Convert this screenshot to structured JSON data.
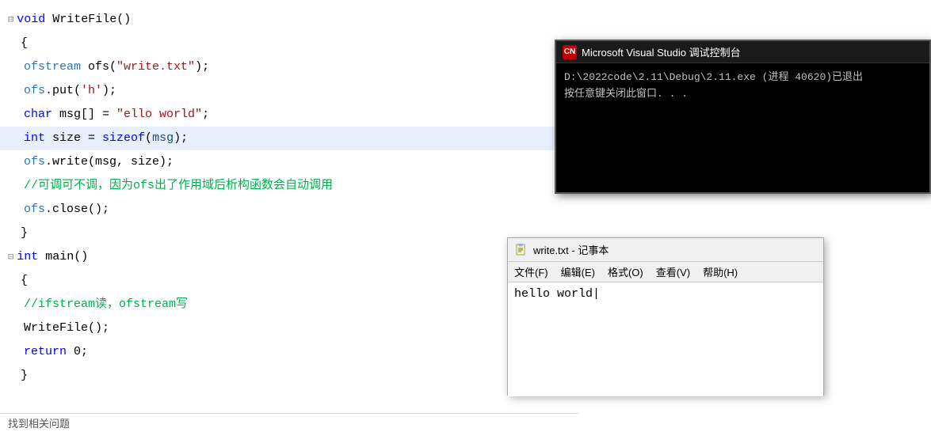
{
  "editor": {
    "lines": [
      {
        "id": "l1",
        "type": "fn-header",
        "collapse": "⊟",
        "indent": 0,
        "tokens": [
          {
            "cls": "kw-void",
            "t": "void"
          },
          {
            "cls": "normal",
            "t": " WriteFile()"
          }
        ]
      },
      {
        "id": "l2",
        "type": "brace",
        "indent": 0,
        "tokens": [
          {
            "cls": "normal",
            "t": "{"
          }
        ]
      },
      {
        "id": "l3",
        "indent": 1,
        "tokens": [
          {
            "cls": "obj-name",
            "t": "ofstream"
          },
          {
            "cls": "normal",
            "t": " ofs("
          },
          {
            "cls": "str-val",
            "t": "\"write.txt\""
          },
          {
            "cls": "normal",
            "t": ");"
          }
        ]
      },
      {
        "id": "l4",
        "indent": 1,
        "tokens": [
          {
            "cls": "obj-name",
            "t": "ofs"
          },
          {
            "cls": "normal",
            "t": ".put("
          },
          {
            "cls": "char-val",
            "t": "'h'"
          },
          {
            "cls": "normal",
            "t": ");"
          }
        ]
      },
      {
        "id": "l5",
        "indent": 1,
        "tokens": [
          {
            "cls": "kw-char",
            "t": "char"
          },
          {
            "cls": "normal",
            "t": " msg[] = "
          },
          {
            "cls": "str-val",
            "t": "\"ello world\""
          },
          {
            "cls": "normal",
            "t": ";"
          }
        ]
      },
      {
        "id": "l6",
        "indent": 1,
        "highlighted": true,
        "tokens": [
          {
            "cls": "kw-int",
            "t": "int"
          },
          {
            "cls": "normal",
            "t": " size = "
          },
          {
            "cls": "kw-sizeof",
            "t": "sizeof"
          },
          {
            "cls": "normal",
            "t": "("
          },
          {
            "cls": "var-name",
            "t": "msg"
          },
          {
            "cls": "normal",
            "t": ");"
          }
        ]
      },
      {
        "id": "l7",
        "indent": 1,
        "tokens": [
          {
            "cls": "obj-name",
            "t": "ofs"
          },
          {
            "cls": "normal",
            "t": ".write("
          },
          {
            "cls": "normal",
            "t": "msg, size);"
          }
        ]
      },
      {
        "id": "l8",
        "indent": 1,
        "tokens": [
          {
            "cls": "comment",
            "t": "//可调可不调，因为ofs出了作用域后析构函数会自动调用"
          }
        ]
      },
      {
        "id": "l9",
        "indent": 1,
        "tokens": [
          {
            "cls": "obj-name",
            "t": "ofs"
          },
          {
            "cls": "normal",
            "t": ".close();"
          }
        ]
      },
      {
        "id": "l10",
        "indent": 0,
        "tokens": [
          {
            "cls": "normal",
            "t": "}"
          }
        ]
      },
      {
        "id": "l11",
        "indent": 0,
        "tokens": []
      },
      {
        "id": "l12",
        "type": "fn-header",
        "collapse": "⊟",
        "indent": 0,
        "tokens": [
          {
            "cls": "kw-int",
            "t": "int"
          },
          {
            "cls": "normal",
            "t": " main()"
          }
        ]
      },
      {
        "id": "l13",
        "indent": 0,
        "tokens": [
          {
            "cls": "normal",
            "t": "{"
          }
        ]
      },
      {
        "id": "l14",
        "indent": 1,
        "tokens": [
          {
            "cls": "comment",
            "t": "//ifstream读，ofstream写"
          }
        ]
      },
      {
        "id": "l15",
        "indent": 1,
        "tokens": [
          {
            "cls": "fn-name",
            "t": "WriteFile"
          },
          {
            "cls": "normal",
            "t": "();"
          }
        ]
      },
      {
        "id": "l16",
        "indent": 1,
        "tokens": [
          {
            "cls": "kw-return",
            "t": "return"
          },
          {
            "cls": "normal",
            "t": " 0;"
          }
        ]
      },
      {
        "id": "l17",
        "indent": 0,
        "tokens": [
          {
            "cls": "normal",
            "t": "}"
          }
        ]
      }
    ],
    "status_bar_text": "找到相关问题"
  },
  "console": {
    "icon_text": "CN",
    "title": "Microsoft Visual Studio 调试控制台",
    "line1": "D:\\2022code\\2.11\\Debug\\2.11.exe (进程 40620)已退出",
    "line2": "按任意键关闭此窗口. . ."
  },
  "notepad": {
    "icon": "notepad",
    "title": "write.txt - 记事本",
    "menu_items": [
      "文件(F)",
      "编辑(E)",
      "格式(O)",
      "查看(V)",
      "帮助(H)"
    ],
    "content": "hello world"
  }
}
